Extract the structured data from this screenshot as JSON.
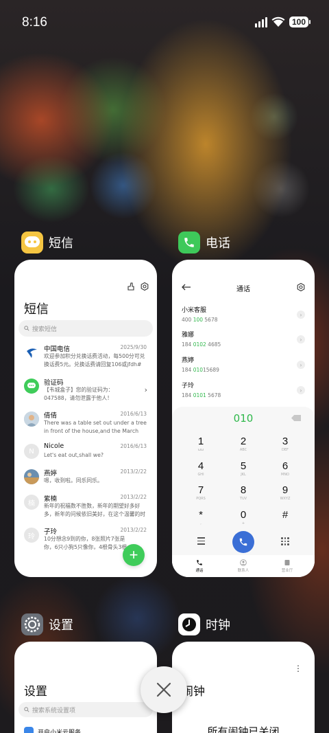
{
  "status_bar": {
    "time": "8:16",
    "battery": "100"
  },
  "apps": {
    "messages": {
      "label": "短信",
      "title": "短信",
      "search_placeholder": "搜索短信",
      "conversations": [
        {
          "name": "中国电信",
          "date": "2025/9/30",
          "snippet": "欢迎参加积分兑换话费活动，每500分可兑换话费5元。兑换话费请回复106或jfdh#话费..."
        },
        {
          "name": "验证码",
          "date": "",
          "snippet": "【韦城盒子】您的验证码为：047588，请勿泄露于他人！"
        },
        {
          "name": "倩倩",
          "date": "2016/6/13",
          "snippet": "There was a table set out under a tree in front of the house,and the March Hare an..."
        },
        {
          "name": "Nicole",
          "date": "2016/6/13",
          "snippet": "Let's eat out,shall we?"
        },
        {
          "name": "燕婷",
          "date": "2013/2/22",
          "snippet": "嗯，收到啦。同乐同乐。"
        },
        {
          "name": "紫楠",
          "date": "2013/2/22",
          "snippet": "新年的祝福数不胜数，新年的期望好多好多，新年的问候依旧美好，在这个温馨的时刻，..."
        },
        {
          "name": "子玲",
          "date": "2013/2/22",
          "snippet": "10分想念9到的你，8张照片7张是你，6只小狗5只像你，4根骨头3根白你，2爪都给你..."
        }
      ],
      "avatar_letters": [
        "",
        "",
        "",
        "N",
        "",
        "楠",
        "玲"
      ],
      "fab": "+"
    },
    "phone": {
      "label": "电话",
      "title": "通话",
      "contacts": [
        {
          "name": "小米客服",
          "pre": "400 ",
          "hl": "100",
          "post": " 5678"
        },
        {
          "name": "雅娜",
          "pre": "184 ",
          "hl": "0102",
          "post": " 4685"
        },
        {
          "name": "燕婷",
          "pre": "184 ",
          "hl": "010",
          "post": "15689"
        },
        {
          "name": "子玲",
          "pre": "184 ",
          "hl": "0101",
          "post": " 5678"
        }
      ],
      "dialed": "010",
      "keys": [
        {
          "d": "1",
          "l": "ωω"
        },
        {
          "d": "2",
          "l": "ABC"
        },
        {
          "d": "3",
          "l": "DEF"
        },
        {
          "d": "4",
          "l": "GHI"
        },
        {
          "d": "5",
          "l": "JKL"
        },
        {
          "d": "6",
          "l": "MNO"
        },
        {
          "d": "7",
          "l": "PQRS"
        },
        {
          "d": "8",
          "l": "TUV"
        },
        {
          "d": "9",
          "l": "WXYZ"
        },
        {
          "d": "*",
          "l": ","
        },
        {
          "d": "0",
          "l": "+"
        },
        {
          "d": "#",
          "l": ""
        }
      ],
      "tabs": [
        "通话",
        "联系人",
        "营业厅"
      ]
    },
    "settings": {
      "label": "设置",
      "title": "设置",
      "search_placeholder": "搜索系统设置项",
      "first_item": "开启小米云服务"
    },
    "clock": {
      "label": "时钟",
      "title": "闹钟",
      "status": "所有闹钟已关闭"
    }
  },
  "colors": {
    "accent_green": "#3fcc5a",
    "call_blue": "#3b6fd6",
    "messages_icon": "#f5c542",
    "phone_icon": "#3ec95a"
  }
}
